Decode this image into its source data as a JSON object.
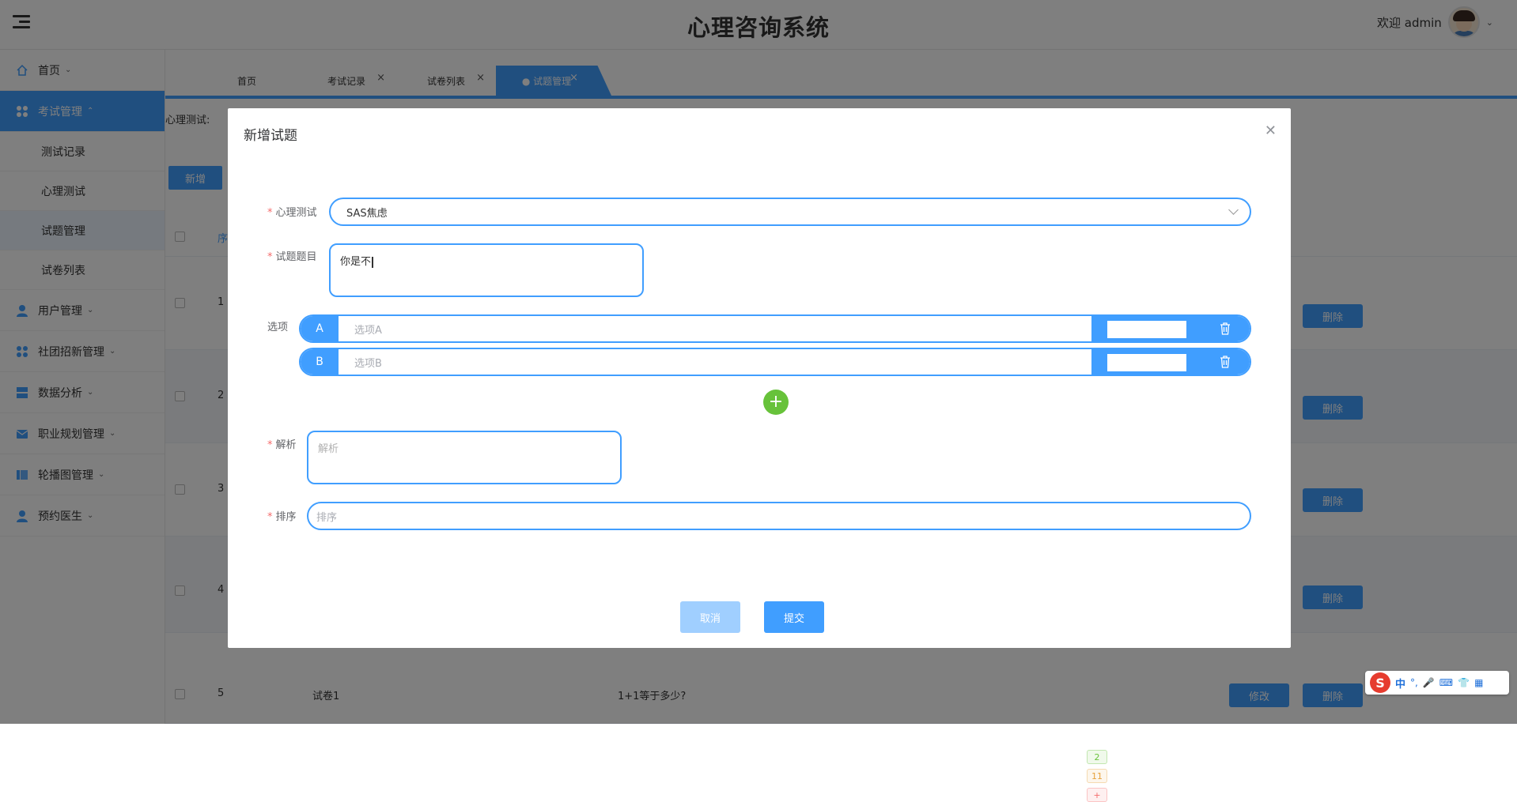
{
  "app": {
    "title": "心理咨询系统",
    "welcome": "欢迎 admin",
    "accent": "#409eff"
  },
  "sidebar": {
    "items": [
      {
        "label": "首页",
        "icon": "home-icon"
      },
      {
        "label": "考试管理",
        "icon": "grid-icon",
        "expanded": true
      },
      {
        "label": "用户管理",
        "icon": "user-icon"
      },
      {
        "label": "社团招新管理",
        "icon": "grid-icon"
      },
      {
        "label": "数据分析",
        "icon": "server-icon"
      },
      {
        "label": "职业规划管理",
        "icon": "mail-icon"
      },
      {
        "label": "轮播图管理",
        "icon": "book-icon"
      },
      {
        "label": "预约医生",
        "icon": "user-icon"
      }
    ],
    "subitems": [
      "测试记录",
      "心理测试",
      "试题管理",
      "试卷列表"
    ],
    "active_sub": "试题管理"
  },
  "tabs": [
    {
      "label": "首页"
    },
    {
      "label": "考试记录"
    },
    {
      "label": "试卷列表"
    },
    {
      "label": "● 试题管理",
      "active": true
    }
  ],
  "page": {
    "filter_label": "心理测试:",
    "add_label": "新增",
    "seq_header": "序",
    "rows": [
      {
        "num": "1",
        "delete": "删除"
      },
      {
        "num": "2",
        "delete": "删除"
      },
      {
        "num": "3",
        "delete": "删除"
      },
      {
        "num": "4",
        "delete": "删除"
      },
      {
        "num": "5",
        "paper": "试卷1",
        "question": "1+1等于多少?",
        "edit": "修改",
        "delete": "删除",
        "chips": [
          "2",
          "11",
          "+"
        ]
      }
    ]
  },
  "dialog": {
    "title": "新增试题",
    "test_label": "心理测试",
    "test_value": "SAS焦虑",
    "question_label": "试题题目",
    "question_value": "你是不",
    "options_label": "选项",
    "options": [
      {
        "letter": "A",
        "placeholder": "选项A"
      },
      {
        "letter": "B",
        "placeholder": "选项B"
      }
    ],
    "analysis_label": "解析",
    "analysis_placeholder": "解析",
    "sort_label": "排序",
    "sort_placeholder": "排序",
    "cancel": "取消",
    "submit": "提交"
  },
  "ime": {
    "logo": "S",
    "mode": "中",
    "punct": "°,"
  }
}
